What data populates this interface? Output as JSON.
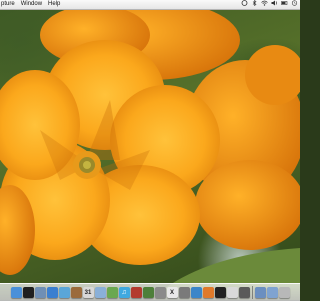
{
  "menubar": {
    "items": [
      "pture",
      "Window",
      "Help"
    ]
  },
  "dock": {
    "icons": [
      {
        "name": "finder-icon",
        "color": "#4a90d9",
        "glyph": ""
      },
      {
        "name": "dashboard-icon",
        "color": "#1f1f1f",
        "glyph": ""
      },
      {
        "name": "mail-icon",
        "color": "#6f8fb5",
        "glyph": ""
      },
      {
        "name": "safari-icon",
        "color": "#3b7fd0",
        "glyph": ""
      },
      {
        "name": "ichat-icon",
        "color": "#5aa6d8",
        "glyph": ""
      },
      {
        "name": "address-book-icon",
        "color": "#9b6b3c",
        "glyph": ""
      },
      {
        "name": "ical-icon",
        "color": "#d8d8d8",
        "glyph": "31"
      },
      {
        "name": "preview-icon",
        "color": "#8ab0d8",
        "glyph": ""
      },
      {
        "name": "iphoto-icon",
        "color": "#6aa84f",
        "glyph": ""
      },
      {
        "name": "itunes-icon",
        "color": "#3fa9e0",
        "glyph": "♫"
      },
      {
        "name": "photo-booth-icon",
        "color": "#b33a2e",
        "glyph": ""
      },
      {
        "name": "spaces-icon",
        "color": "#4d7f3a",
        "glyph": ""
      },
      {
        "name": "system-preferences-icon",
        "color": "#8a8a8a",
        "glyph": ""
      },
      {
        "name": "x11-icon",
        "color": "#e8e8e8",
        "glyph": "X"
      },
      {
        "name": "chess-icon",
        "color": "#7a7a7a",
        "glyph": ""
      },
      {
        "name": "network-icon",
        "color": "#3b86c9",
        "glyph": ""
      },
      {
        "name": "firefox-icon",
        "color": "#e07a2a",
        "glyph": ""
      },
      {
        "name": "terminal-icon",
        "color": "#222222",
        "glyph": ""
      },
      {
        "name": "text-edit-icon",
        "color": "#d9d9d9",
        "glyph": ""
      },
      {
        "name": "calculator-icon",
        "color": "#5a5a5a",
        "glyph": ""
      },
      {
        "name": "downloads-stack-icon",
        "color": "#6b8fc0",
        "glyph": ""
      },
      {
        "name": "documents-stack-icon",
        "color": "#7fa3d0",
        "glyph": ""
      },
      {
        "name": "trash-icon",
        "color": "#b8b8b8",
        "glyph": ""
      }
    ]
  }
}
